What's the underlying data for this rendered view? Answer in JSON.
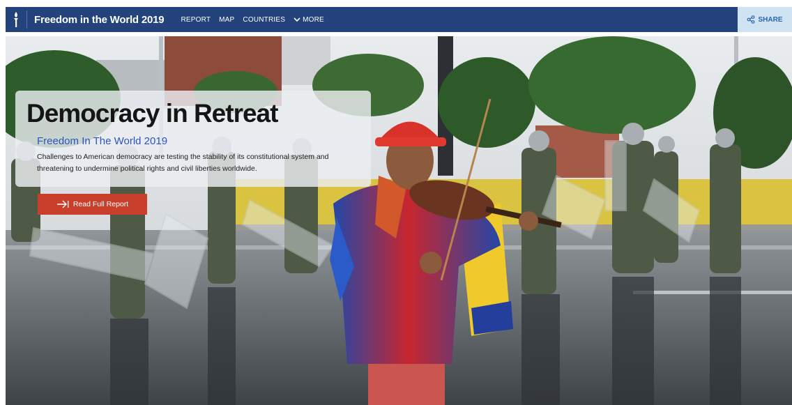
{
  "navbar": {
    "title": "Freedom in the World 2019",
    "links": [
      "REPORT",
      "MAP",
      "COUNTRIES"
    ],
    "more_label": "MORE",
    "share_label": "SHARE"
  },
  "hero": {
    "headline": "Democracy in Retreat",
    "subtitle": "Freedom In The World 2019",
    "description": "Challenges to American democracy are testing the stability of its constitutional system and threatening to undermine political rights and civil liberties worldwide.",
    "cta_label": "Read Full Report"
  },
  "colors": {
    "nav_bg": "#24427c",
    "share_bg": "#cfe3f3",
    "share_text": "#2d63b0",
    "cta_bg": "#c8402c",
    "subtitle": "#2b56c0"
  },
  "icons": {
    "logo": "torch-icon",
    "more": "chevron-down-icon",
    "share": "share-icon",
    "cta": "arrow-right-icon"
  }
}
